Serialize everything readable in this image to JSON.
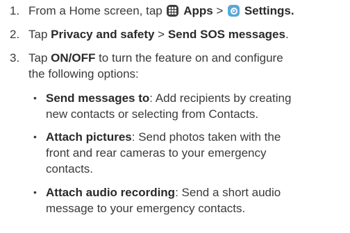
{
  "steps": [
    {
      "number": "1.",
      "pre": "From a Home screen, tap ",
      "apps_label": "Apps",
      "sep1": " > ",
      "settings_label": "Settings."
    },
    {
      "number": "2.",
      "pre": "Tap ",
      "b1": "Privacy and safety",
      "sep": " > ",
      "b2": "Send SOS messages",
      "post": "."
    },
    {
      "number": "3.",
      "pre": "Tap ",
      "b1": "ON/OFF",
      "line1_post": " to turn the feature on and configure",
      "line2": "the following options:"
    }
  ],
  "options": [
    {
      "bullet": "•",
      "title": "Send messages to",
      "line1": ": Add recipients by creating",
      "line2": "new contacts or selecting from Contacts."
    },
    {
      "bullet": "•",
      "title": "Attach pictures",
      "line1": ": Send photos taken with the",
      "line2": "front and rear cameras to your emergency",
      "line3": "contacts."
    },
    {
      "bullet": "•",
      "title": "Attach audio recording",
      "line1": ": Send a short audio",
      "line2": "message to your emergency contacts."
    }
  ],
  "icons": {
    "apps": "apps-grid-icon",
    "settings": "settings-gear-icon"
  },
  "colors": {
    "text": "#3a3a3a",
    "apps_icon": "#3d3d3d",
    "settings_icon": "#5aa7d8"
  }
}
